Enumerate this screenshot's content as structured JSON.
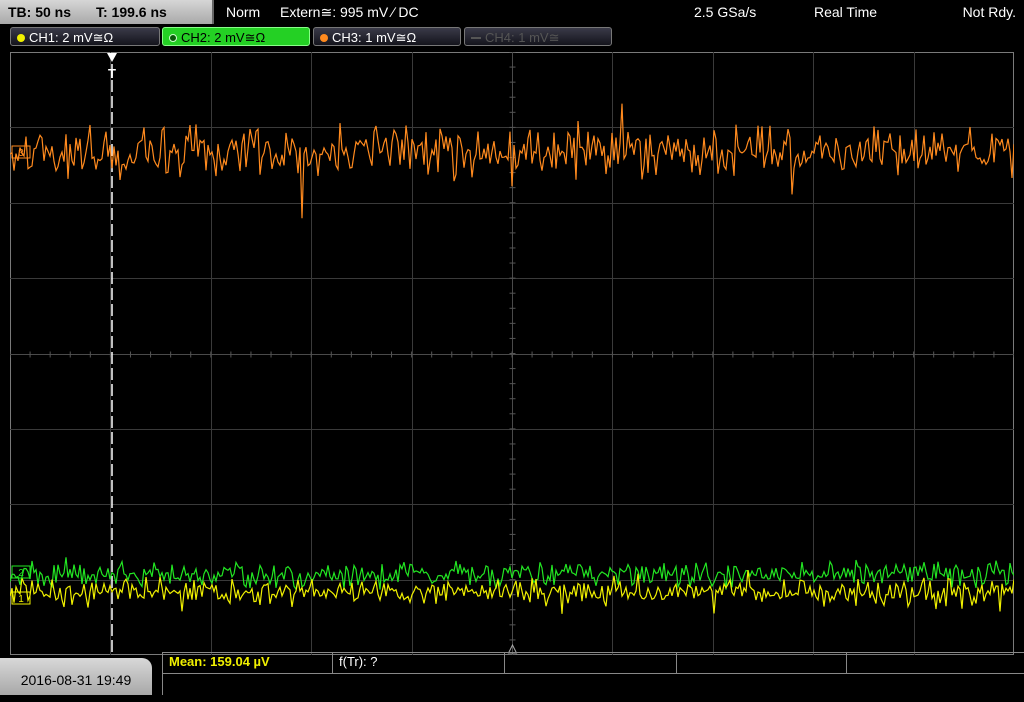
{
  "top_bar": {
    "timebase": "TB: 50 ns",
    "trigger_time": "T: 199.6 ns",
    "trigger_mode": "Norm",
    "trigger_source": "Extern≅: 995 mV ∕ DC",
    "sample_rate": "2.5 GSa/s",
    "acq_mode": "Real Time",
    "status": "Not Rdy."
  },
  "channels": [
    {
      "label": "CH1: 2 mV≅Ω",
      "color": "#f0f000",
      "state": "on"
    },
    {
      "label": "CH2: 2 mV≅Ω",
      "color": "#1ed41e",
      "state": "active"
    },
    {
      "label": "CH3: 1 mV≅Ω",
      "color": "#ff8a1e",
      "state": "on"
    },
    {
      "label": "CH4: 1 mV≅",
      "color": "#555555",
      "state": "off"
    }
  ],
  "waveforms": {
    "ch3": {
      "color": "#ff8a1e",
      "marker": "3"
    },
    "ch2": {
      "color": "#22e622",
      "marker": "2"
    },
    "ch1": {
      "color": "#f0f000",
      "marker": "1"
    }
  },
  "trigger_marker": "T",
  "bottom_bar": {
    "datetime": "2016-08-31 19:49",
    "measurements": [
      {
        "label": "Mean: 159.04 µV",
        "color": "#f0f000"
      },
      {
        "label": "f(Tr): ?",
        "color": "#ffffff"
      }
    ]
  }
}
